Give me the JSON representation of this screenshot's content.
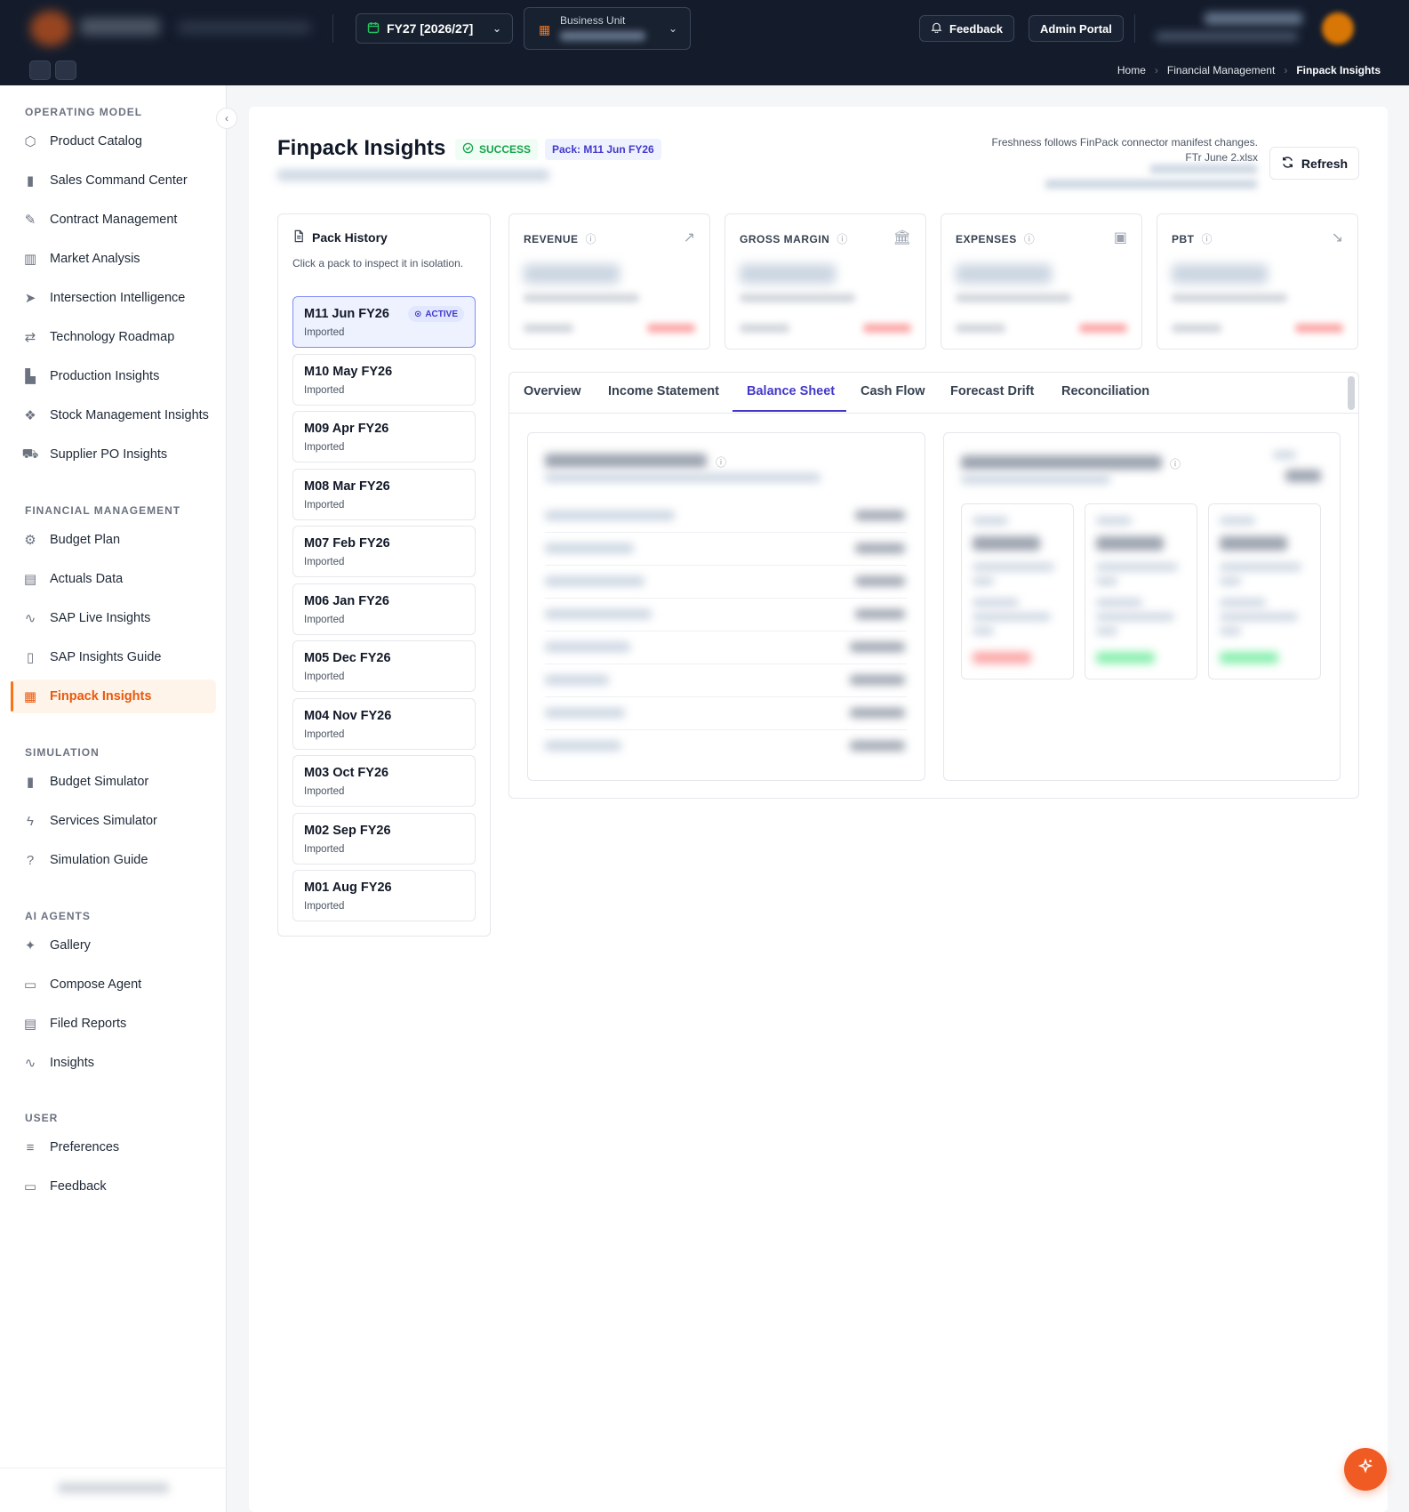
{
  "header": {
    "fiscal_year": "FY27 [2026/27]",
    "business_unit_label": "Business Unit",
    "feedback_label": "Feedback",
    "admin_label": "Admin Portal",
    "breadcrumb": [
      "Home",
      "Financial Management",
      "Finpack Insights"
    ]
  },
  "sidebar": {
    "sections": [
      {
        "title": "OPERATING MODEL",
        "items": [
          {
            "label": "Product Catalog",
            "icon": "package-icon"
          },
          {
            "label": "Sales Command Center",
            "icon": "bar-chart-icon"
          },
          {
            "label": "Contract Management",
            "icon": "edit-document-icon"
          },
          {
            "label": "Market Analysis",
            "icon": "map-icon"
          },
          {
            "label": "Intersection Intelligence",
            "icon": "send-icon"
          },
          {
            "label": "Technology Roadmap",
            "icon": "route-icon"
          },
          {
            "label": "Production Insights",
            "icon": "factory-icon"
          },
          {
            "label": "Stock Management Insights",
            "icon": "boxes-icon"
          },
          {
            "label": "Supplier PO Insights",
            "icon": "cart-icon"
          }
        ]
      },
      {
        "title": "FINANCIAL MANAGEMENT",
        "items": [
          {
            "label": "Budget Plan",
            "icon": "settings-icon"
          },
          {
            "label": "Actuals Data",
            "icon": "document-icon"
          },
          {
            "label": "SAP Live Insights",
            "icon": "activity-icon"
          },
          {
            "label": "SAP Insights Guide",
            "icon": "book-icon"
          },
          {
            "label": "Finpack Insights",
            "icon": "spreadsheet-icon",
            "active": true
          }
        ]
      },
      {
        "title": "SIMULATION",
        "items": [
          {
            "label": "Budget Simulator",
            "icon": "bar-chart-icon"
          },
          {
            "label": "Services Simulator",
            "icon": "bolt-icon"
          },
          {
            "label": "Simulation Guide",
            "icon": "help-circle-icon"
          }
        ]
      },
      {
        "title": "AI AGENTS",
        "items": [
          {
            "label": "Gallery",
            "icon": "sparkles-icon"
          },
          {
            "label": "Compose Agent",
            "icon": "message-icon"
          },
          {
            "label": "Filed Reports",
            "icon": "document-icon"
          },
          {
            "label": "Insights",
            "icon": "activity-icon"
          }
        ]
      },
      {
        "title": "USER",
        "items": [
          {
            "label": "Preferences",
            "icon": "sliders-icon"
          },
          {
            "label": "Feedback",
            "icon": "message-icon"
          }
        ]
      }
    ]
  },
  "page": {
    "title": "Finpack Insights",
    "status": "SUCCESS",
    "pack_badge": "Pack: M11 Jun FY26",
    "freshness_note": "Freshness follows FinPack connector manifest changes.",
    "file_name": "FTr June 2.xlsx",
    "refresh_label": "Refresh"
  },
  "pack_history": {
    "title": "Pack History",
    "description": "Click a pack to inspect it in isolation.",
    "active_label": "ACTIVE",
    "packs": [
      {
        "name": "M11 Jun FY26",
        "status": "Imported",
        "active": true
      },
      {
        "name": "M10 May FY26",
        "status": "Imported"
      },
      {
        "name": "M09 Apr FY26",
        "status": "Imported"
      },
      {
        "name": "M08 Mar FY26",
        "status": "Imported"
      },
      {
        "name": "M07 Feb FY26",
        "status": "Imported"
      },
      {
        "name": "M06 Jan FY26",
        "status": "Imported"
      },
      {
        "name": "M05 Dec FY26",
        "status": "Imported"
      },
      {
        "name": "M04 Nov FY26",
        "status": "Imported"
      },
      {
        "name": "M03 Oct FY26",
        "status": "Imported"
      },
      {
        "name": "M02 Sep FY26",
        "status": "Imported"
      },
      {
        "name": "M01 Aug FY26",
        "status": "Imported"
      }
    ]
  },
  "kpis": [
    {
      "title": "REVENUE",
      "icon": "trending-up-icon"
    },
    {
      "title": "GROSS MARGIN",
      "icon": "bank-icon"
    },
    {
      "title": "EXPENSES",
      "icon": "wallet-icon"
    },
    {
      "title": "PBT",
      "icon": "trending-down-icon"
    }
  ],
  "tabs": [
    {
      "label": "Overview"
    },
    {
      "label": "Income Statement"
    },
    {
      "label": "Balance Sheet",
      "active": true
    },
    {
      "label": "Cash Flow"
    },
    {
      "label": "Forecast Drift"
    },
    {
      "label": "Reconciliation"
    }
  ],
  "colors": {
    "accent": "#f97316",
    "nav_bar": "#141c2c",
    "tab_active": "#4338ca",
    "success": "#16a34a"
  }
}
